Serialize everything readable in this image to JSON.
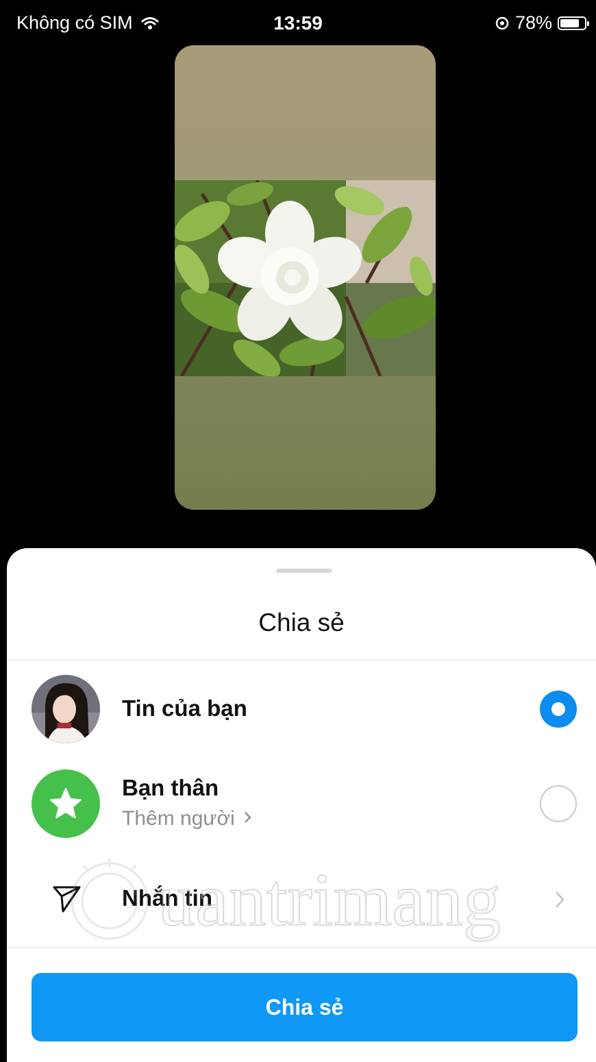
{
  "status_bar": {
    "carrier": "Không có SIM",
    "time": "13:59",
    "battery_percent": "78%",
    "battery_level": 0.78
  },
  "sheet": {
    "title": "Chia sẻ",
    "options": [
      {
        "label": "Tin của bạn",
        "selected": true
      },
      {
        "label": "Bạn thân",
        "sublabel": "Thêm người",
        "selected": false
      },
      {
        "label": "Nhắn tin"
      }
    ],
    "share_button": "Chia sẻ"
  },
  "watermark": "uantrimang",
  "colors": {
    "accent": "#0f98f5",
    "radio_selected": "#0a8cf0",
    "close_friends": "#45c14b"
  }
}
